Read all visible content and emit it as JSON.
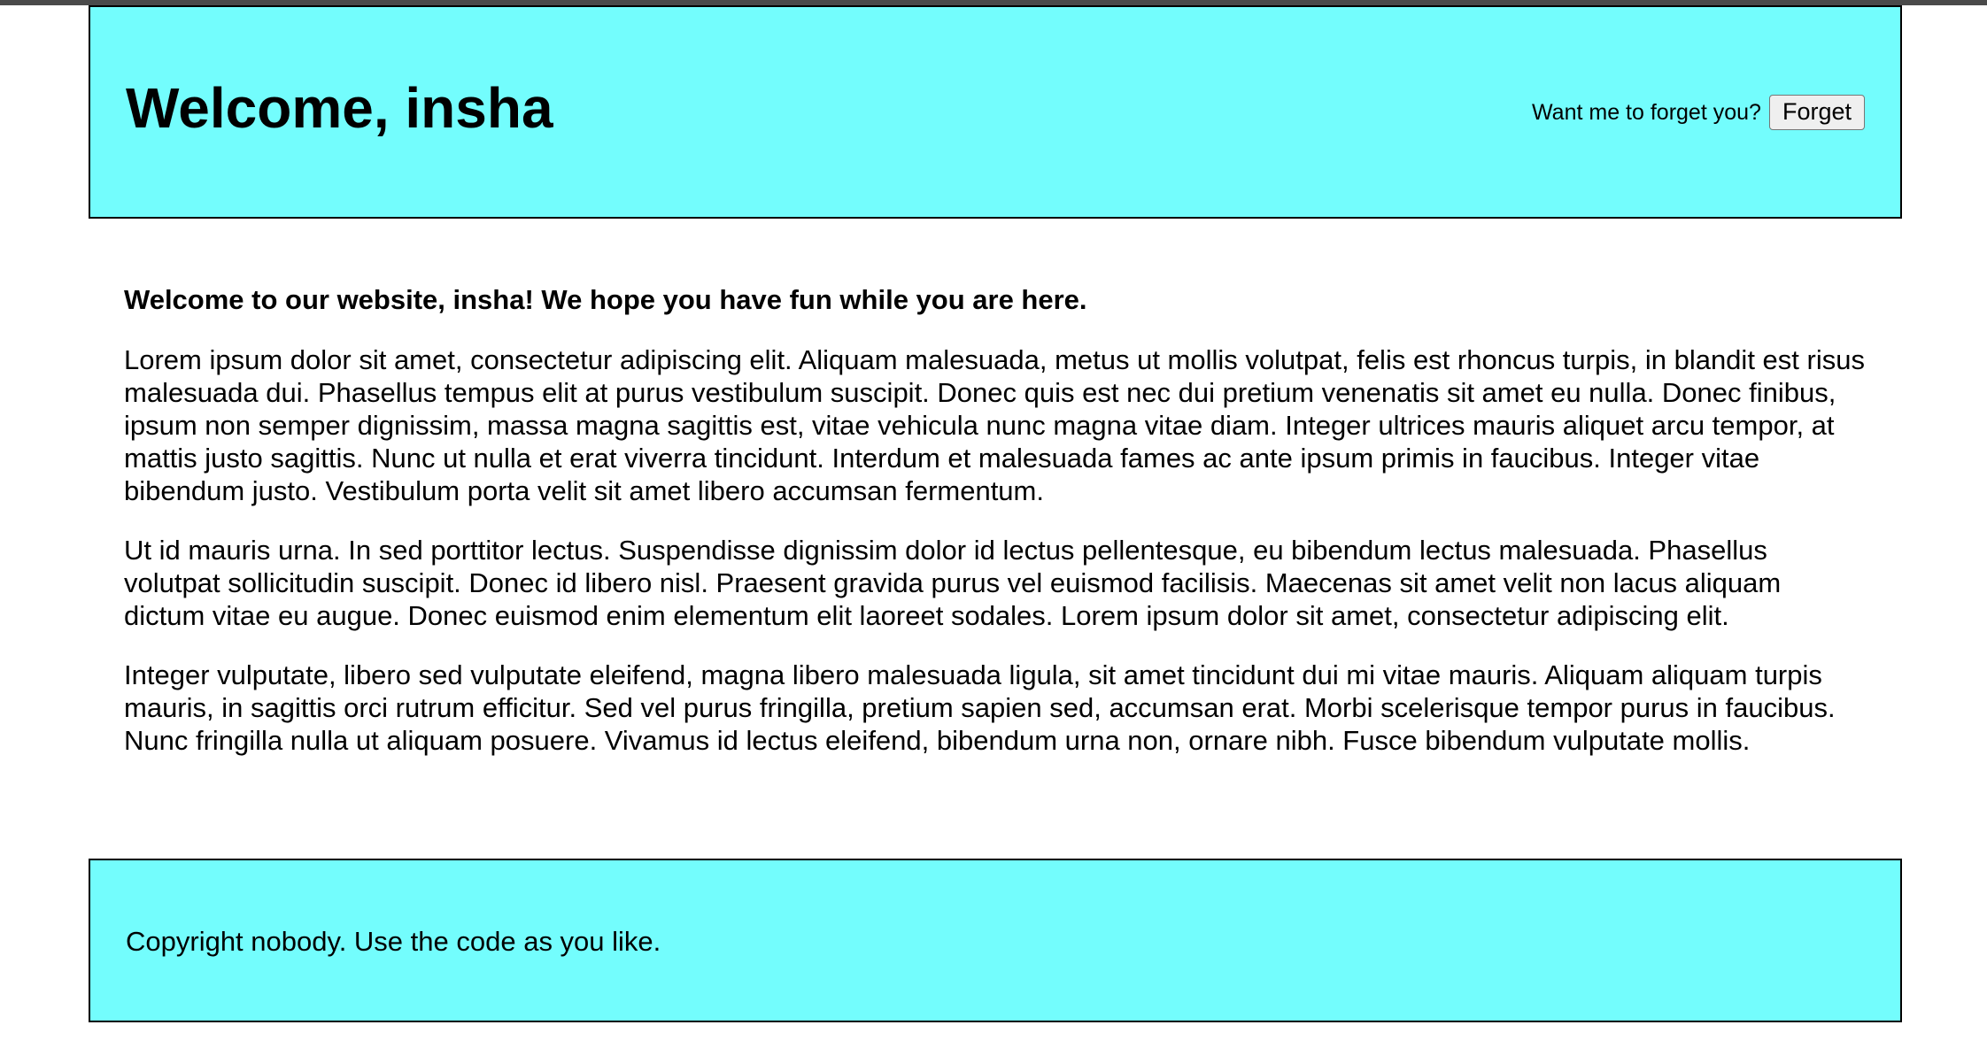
{
  "header": {
    "title": "Welcome, insha",
    "forget_prompt": "Want me to forget you?",
    "forget_button_label": "Forget"
  },
  "main": {
    "intro": "Welcome to our website, insha! We hope you have fun while you are here.",
    "paragraphs": [
      "Lorem ipsum dolor sit amet, consectetur adipiscing elit. Aliquam malesuada, metus ut mollis volutpat, felis est rhoncus turpis, in blandit est risus malesuada dui. Phasellus tempus elit at purus vestibulum suscipit. Donec quis est nec dui pretium venenatis sit amet eu nulla. Donec finibus, ipsum non semper dignissim, massa magna sagittis est, vitae vehicula nunc magna vitae diam. Integer ultrices mauris aliquet arcu tempor, at mattis justo sagittis. Nunc ut nulla et erat viverra tincidunt. Interdum et malesuada fames ac ante ipsum primis in faucibus. Integer vitae bibendum justo. Vestibulum porta velit sit amet libero accumsan fermentum.",
      "Ut id mauris urna. In sed porttitor lectus. Suspendisse dignissim dolor id lectus pellentesque, eu bibendum lectus malesuada. Phasellus volutpat sollicitudin suscipit. Donec id libero nisl. Praesent gravida purus vel euismod facilisis. Maecenas sit amet velit non lacus aliquam dictum vitae eu augue. Donec euismod enim elementum elit laoreet sodales. Lorem ipsum dolor sit amet, consectetur adipiscing elit.",
      "Integer vulputate, libero sed vulputate eleifend, magna libero malesuada ligula, sit amet tincidunt dui mi vitae mauris. Aliquam aliquam turpis mauris, in sagittis orci rutrum efficitur. Sed vel purus fringilla, pretium sapien sed, accumsan erat. Morbi scelerisque tempor purus in faucibus. Nunc fringilla nulla ut aliquam posuere. Vivamus id lectus eleifend, bibendum urna non, ornare nibh. Fusce bibendum vulputate mollis."
    ]
  },
  "footer": {
    "text": "Copyright nobody. Use the code as you like."
  },
  "colors": {
    "header_background": "#73fdfd",
    "footer_background": "#73fdfd",
    "border": "#000000",
    "text": "#000000"
  }
}
